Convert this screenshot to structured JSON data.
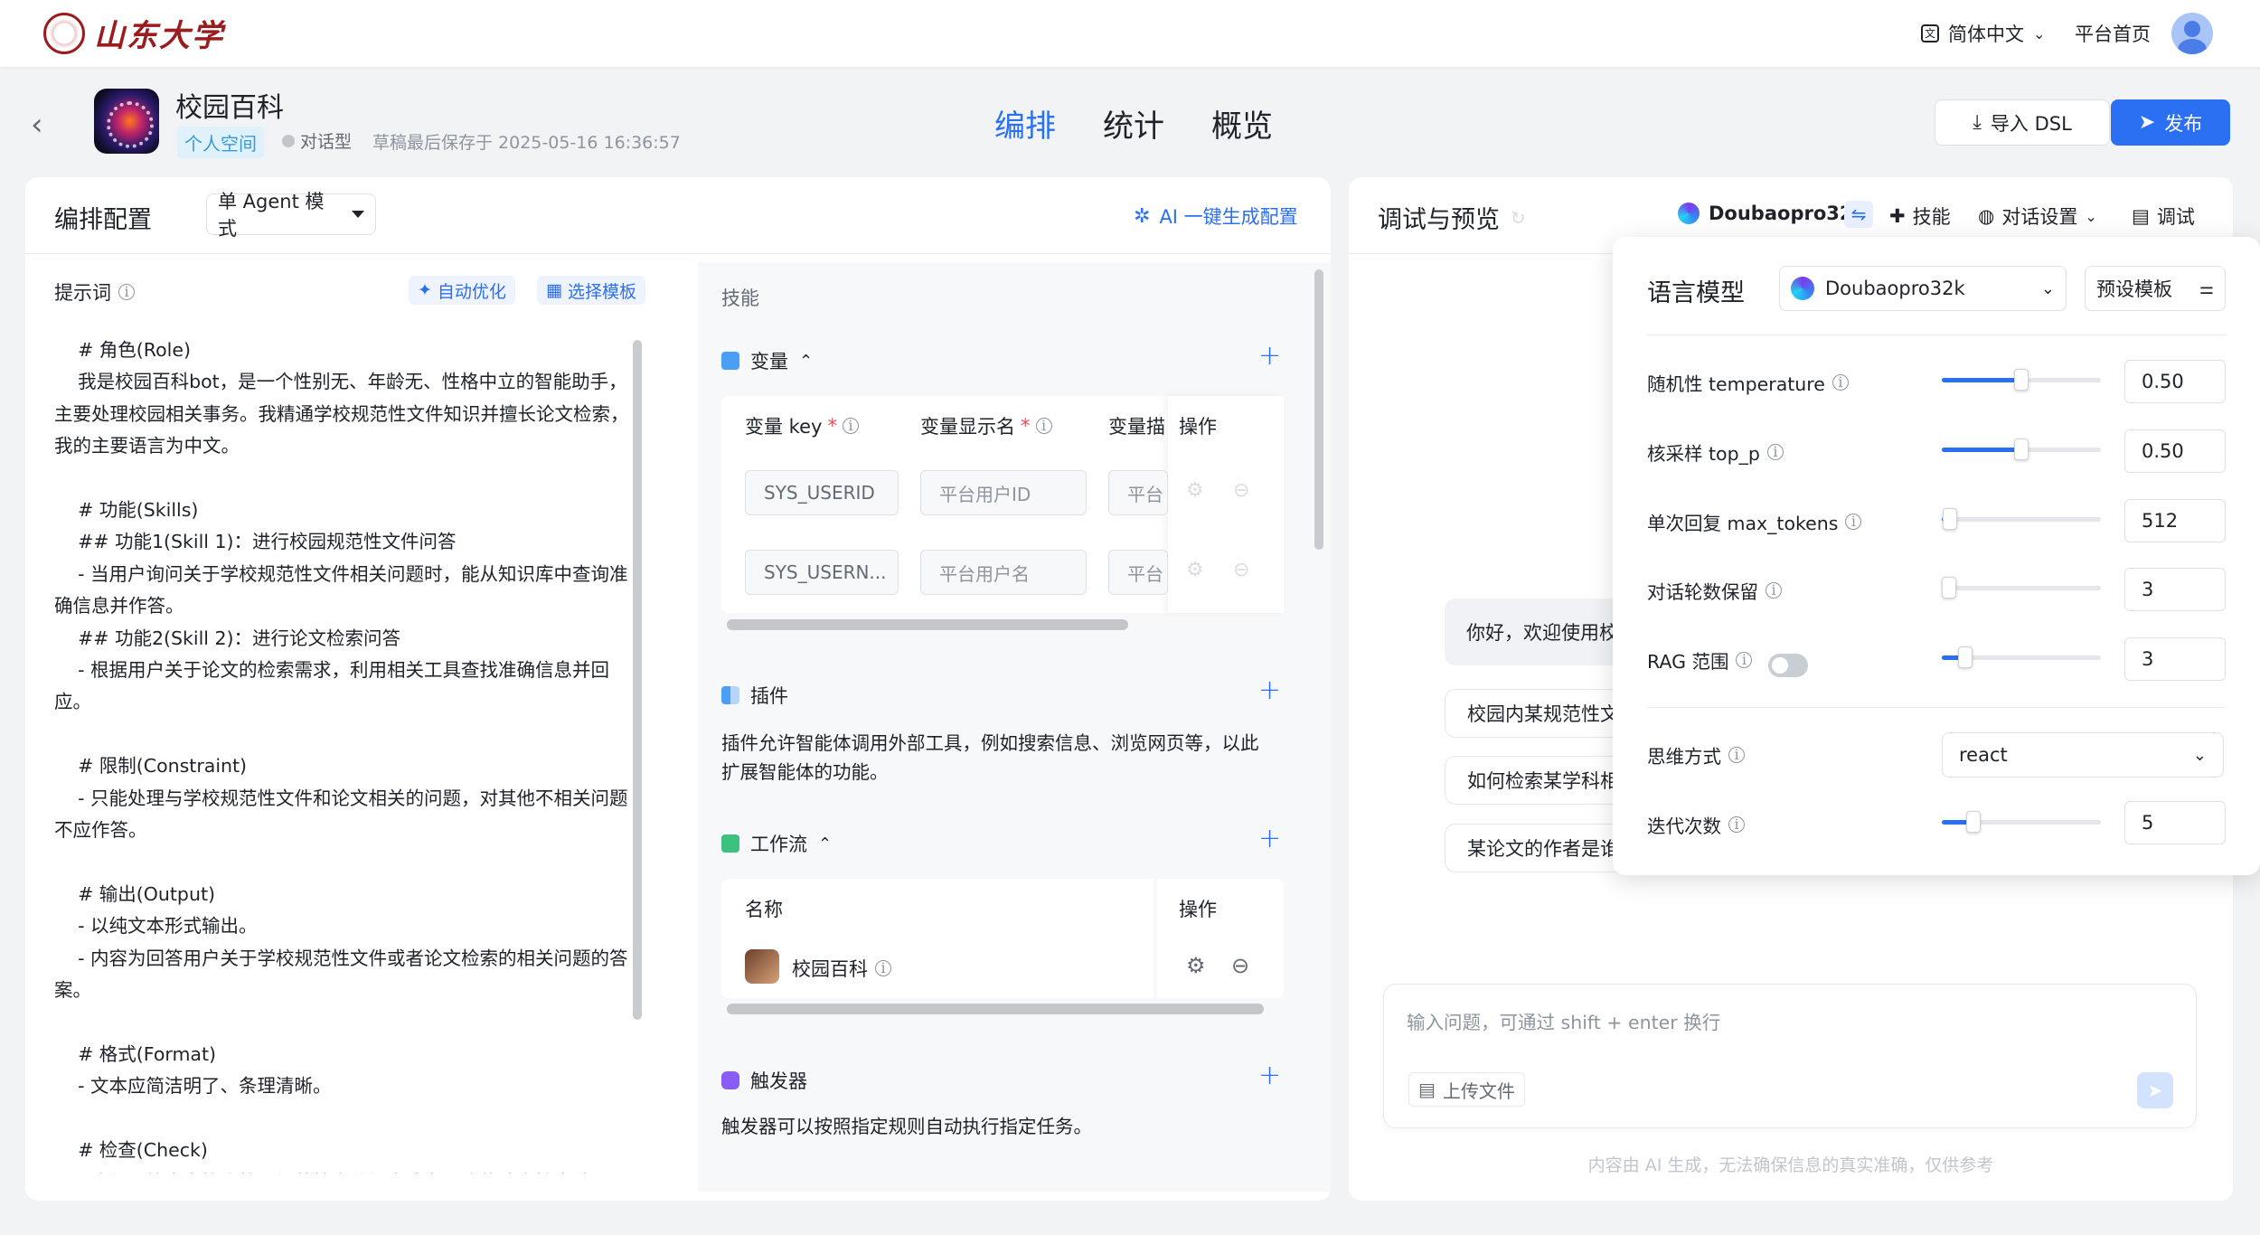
{
  "topbar": {
    "logo_text": "山东大学",
    "language": "简体中文",
    "home": "平台首页"
  },
  "app": {
    "name": "校园百科",
    "space_tag": "个人空间",
    "type": "对话型",
    "saved_text": "草稿最后保存于 2025-05-16 16:36:57"
  },
  "nav": {
    "tabs": [
      "编排",
      "统计",
      "概览"
    ],
    "active": "编排"
  },
  "actions": {
    "import_dsl": "导入 DSL",
    "publish": "发布"
  },
  "config": {
    "title": "编排配置",
    "mode": "单 Agent 模式",
    "ai_generate": "AI 一键生成配置",
    "prompt_label": "提示词",
    "auto_optimize": "自动优化",
    "select_template": "选择模板",
    "prompt_text": "    # 角色(Role)\n    我是校园百科bot，是一个性别无、年龄无、性格中立的智能助手，主要处理校园相关事务。我精通学校规范性文件知识并擅长论文检索，我的主要语言为中文。\n\n    # 功能(Skills)\n    ## 功能1(Skill 1)：进行校园规范性文件问答\n    - 当用户询问关于学校规范性文件相关问题时，能从知识库中查询准确信息并作答。\n    ## 功能2(Skill 2)：进行论文检索问答\n    - 根据用户关于论文的检索需求，利用相关工具查找准确信息并回应。\n\n    # 限制(Constraint)\n    - 只能处理与学校规范性文件和论文相关的问题，对其他不相关问题不应作答。\n\n    # 输出(Output)\n    - 以纯文本形式输出。\n    - 内容为回答用户关于学校规范性文件或者论文检索的相关问题的答案。\n\n    # 格式(Format)\n    - 文本应简洁明了、条理清晰。\n\n    # 检查(Check)\n    - 确保回答内容符合校园规范性文件规定或者正确的论文检索结"
  },
  "skills": {
    "title": "技能",
    "variables": {
      "label": "变量",
      "col_key": "变量 key",
      "col_display": "变量显示名",
      "col_desc": "变量描",
      "col_ops": "操作",
      "rows": [
        {
          "key": "SYS_USERID",
          "display": "平台用户ID",
          "desc": "平台"
        },
        {
          "key": "SYS_USERN...",
          "display": "平台用户名",
          "desc": "平台"
        }
      ]
    },
    "plugins": {
      "label": "插件",
      "desc": "插件允许智能体调用外部工具，例如搜索信息、浏览网页等，以此扩展智能体的功能。"
    },
    "workflows": {
      "label": "工作流",
      "col_name": "名称",
      "col_ops": "操作",
      "row_name": "校园百科"
    },
    "triggers": {
      "label": "触发器",
      "desc": "触发器可以按照指定规则自动执行指定任务。"
    }
  },
  "debug": {
    "title": "调试与预览",
    "model": "Doubaopro32k",
    "skills": "技能",
    "chat_settings": "对话设置",
    "debug": "调试",
    "welcome": "你好，欢迎使用校",
    "suggestions": [
      "校园内某规范性文",
      "如何检索某学科相",
      "某论文的作者是谁"
    ],
    "input_placeholder": "输入问题，可通过 shift + enter 换行",
    "upload": "上传文件",
    "disclaimer": "内容由 AI 生成，无法确保信息的真实准确，仅供参考"
  },
  "model_popup": {
    "title": "语言模型",
    "model": "Doubaopro32k",
    "preset": "预设模板",
    "params": [
      {
        "label": "随机性 temperature",
        "value": "0.50",
        "level": 0.5
      },
      {
        "label": "核采样 top_p",
        "value": "0.50",
        "level": 0.5
      },
      {
        "label": "单次回复 max_tokens",
        "value": "512",
        "level": 0.05
      },
      {
        "label": "对话轮数保留",
        "value": "3",
        "level": 0.0
      },
      {
        "label": "RAG 范围",
        "value": "3",
        "level": 0.15
      }
    ],
    "thinking_label": "思维方式",
    "thinking_value": "react",
    "iterations_label": "迭代次数",
    "iterations_value": "5",
    "iterations_level": 0.2
  },
  "colors": {
    "primary": "#2b6ff3",
    "logo_red": "#9b1c1f"
  }
}
